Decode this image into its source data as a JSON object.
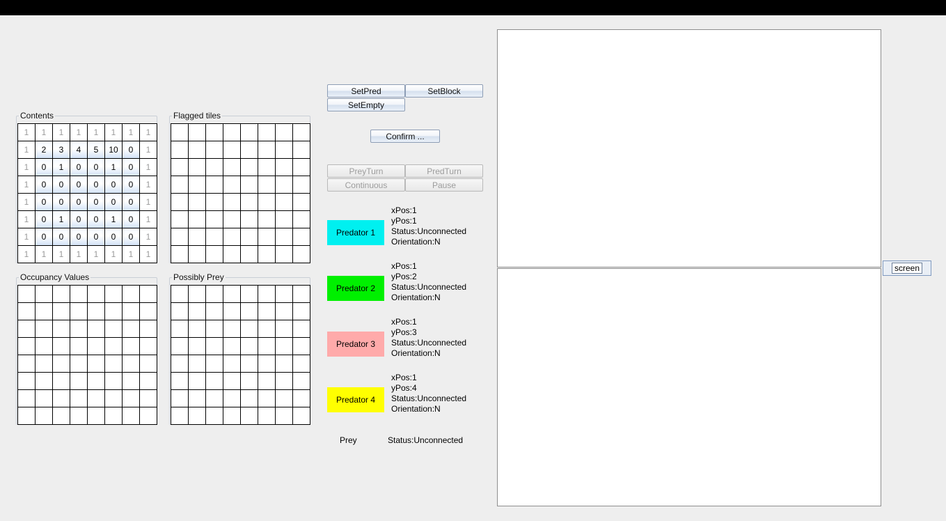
{
  "panels": {
    "contents": {
      "title": "Contents",
      "rows": [
        [
          "1",
          "1",
          "1",
          "1",
          "1",
          "1",
          "1",
          "1"
        ],
        [
          "1",
          "2",
          "3",
          "4",
          "5",
          "10",
          "0",
          "1"
        ],
        [
          "1",
          "0",
          "1",
          "0",
          "0",
          "1",
          "0",
          "1"
        ],
        [
          "1",
          "0",
          "0",
          "0",
          "0",
          "0",
          "0",
          "1"
        ],
        [
          "1",
          "0",
          "0",
          "0",
          "0",
          "0",
          "0",
          "1"
        ],
        [
          "1",
          "0",
          "1",
          "0",
          "0",
          "1",
          "0",
          "1"
        ],
        [
          "1",
          "0",
          "0",
          "0",
          "0",
          "0",
          "0",
          "1"
        ],
        [
          "1",
          "1",
          "1",
          "1",
          "1",
          "1",
          "1",
          "1"
        ]
      ]
    },
    "flagged": {
      "title": "Flagged tiles"
    },
    "occupancy": {
      "title": "Occupancy Values"
    },
    "possibly_prey": {
      "title": "Possibly Prey"
    }
  },
  "buttons": {
    "set_pred": "SetPred",
    "set_block": "SetBlock",
    "set_empty": "SetEmpty",
    "confirm": "Confirm ...",
    "prey_turn": "PreyTurn",
    "pred_turn": "PredTurn",
    "continuous": "Continuous",
    "pause": "Pause",
    "screen": "screen"
  },
  "predators": [
    {
      "label": "Predator 1",
      "color": "#00f0f0",
      "xpos": "xPos:1",
      "ypos": "yPos:1",
      "status": "Status:Unconnected",
      "orientation": "Orientation:N"
    },
    {
      "label": "Predator 2",
      "color": "#00f000",
      "xpos": "xPos:1",
      "ypos": "yPos:2",
      "status": "Status:Unconnected",
      "orientation": "Orientation:N"
    },
    {
      "label": "Predator 3",
      "color": "#ffaaaa",
      "xpos": "xPos:1",
      "ypos": "yPos:3",
      "status": "Status:Unconnected",
      "orientation": "Orientation:N"
    },
    {
      "label": "Predator 4",
      "color": "#ffff00",
      "xpos": "xPos:1",
      "ypos": "yPos:4",
      "status": "Status:Unconnected",
      "orientation": "Orientation:N"
    }
  ],
  "prey": {
    "label": "Prey",
    "status": "Status:Unconnected"
  }
}
